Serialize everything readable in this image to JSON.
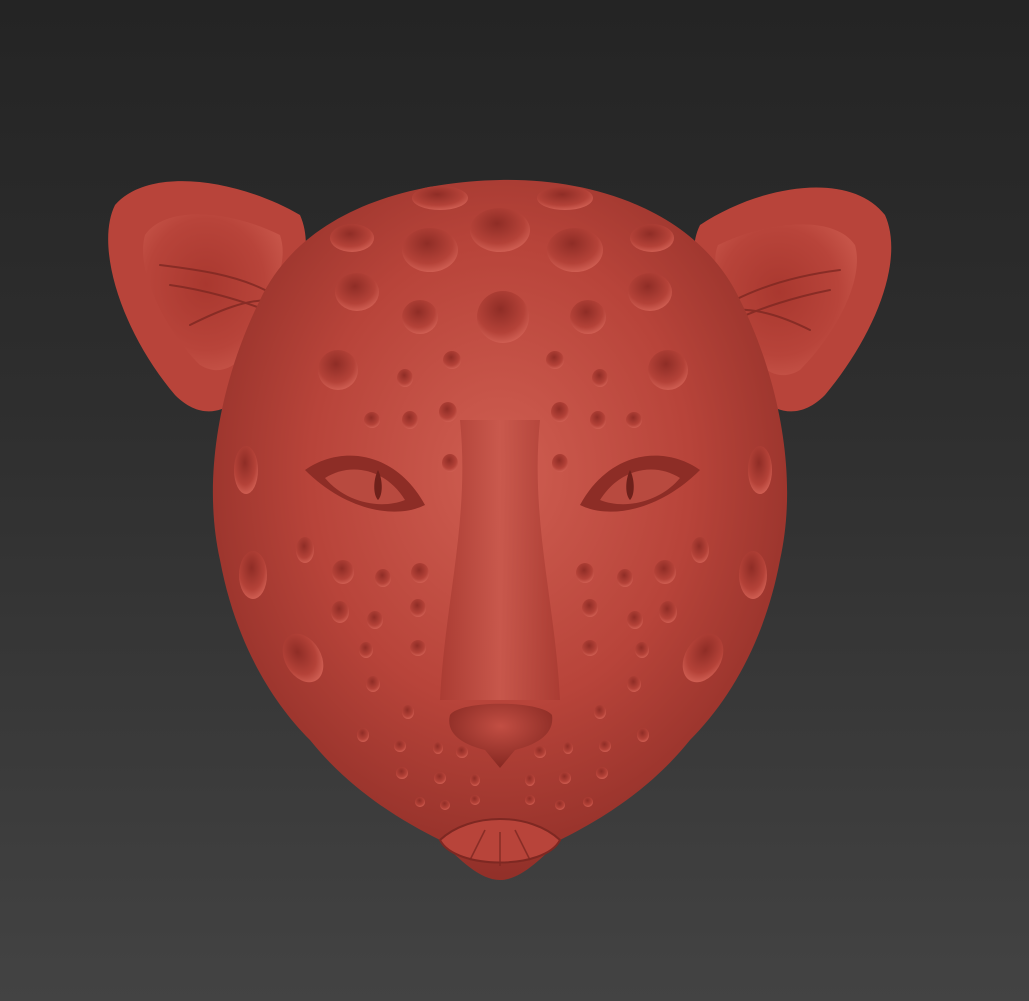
{
  "viewport": {
    "background_top": "#242424",
    "background_bottom": "#434343"
  },
  "model": {
    "subject": "leopard-head-sculpt",
    "clay_color": "#b8443a",
    "highlight_color": "#d3685a",
    "shadow_color": "#7a2620"
  }
}
